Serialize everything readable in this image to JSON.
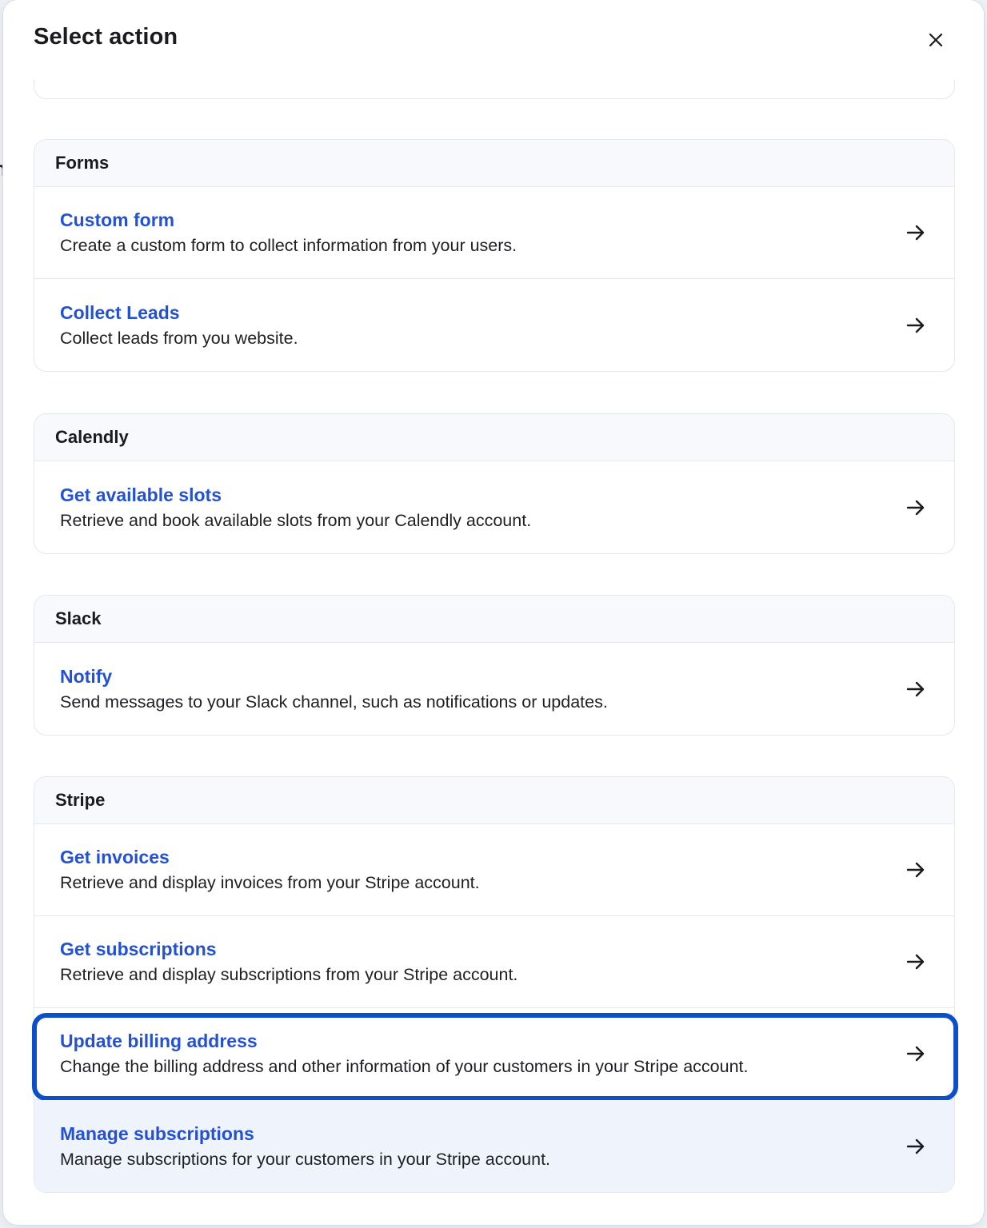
{
  "background": {
    "partial_text": "n"
  },
  "modal": {
    "title": "Select action",
    "close_icon": "close-icon"
  },
  "groups": [
    {
      "name": "Forms",
      "items": [
        {
          "title": "Custom form",
          "description": "Create a custom form to collect information from your users."
        },
        {
          "title": "Collect Leads",
          "description": "Collect leads from you website."
        }
      ]
    },
    {
      "name": "Calendly",
      "items": [
        {
          "title": "Get available slots",
          "description": "Retrieve and book available slots from your Calendly account."
        }
      ]
    },
    {
      "name": "Slack",
      "items": [
        {
          "title": "Notify",
          "description": "Send messages to your Slack channel, such as notifications or updates."
        }
      ]
    },
    {
      "name": "Stripe",
      "items": [
        {
          "title": "Get invoices",
          "description": "Retrieve and display invoices from your Stripe account."
        },
        {
          "title": "Get subscriptions",
          "description": "Retrieve and display subscriptions from your Stripe account."
        },
        {
          "title": "Update billing address",
          "description": "Change the billing address and other information of your customers in your Stripe account.",
          "state": "focused"
        },
        {
          "title": "Manage subscriptions",
          "description": "Manage subscriptions for your customers in your Stripe account.",
          "state": "hovered"
        }
      ]
    }
  ],
  "icons": {
    "item_arrow": "arrow-right-icon"
  },
  "colors": {
    "link_blue": "#2451d1",
    "focus_ring": "#0b4fc9",
    "hover_bg": "#eef3fc",
    "header_bg": "#f7f9fc"
  }
}
